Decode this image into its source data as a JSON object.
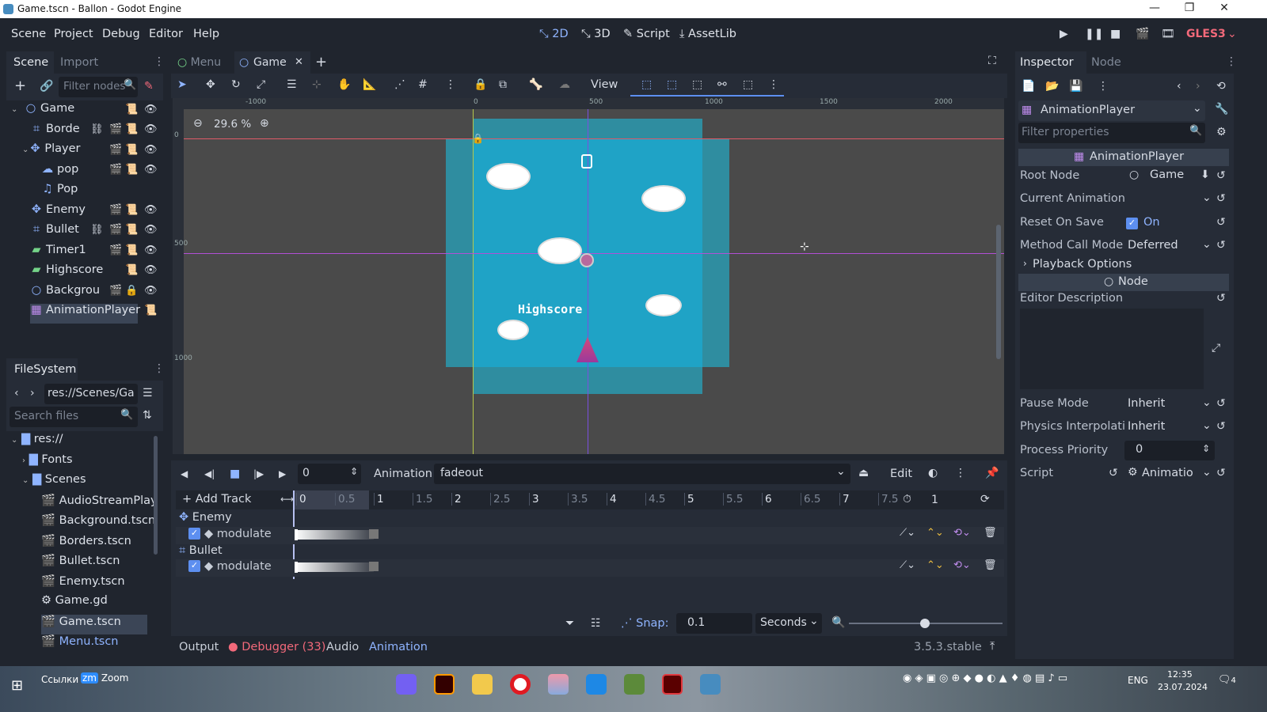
{
  "window": {
    "title": "Game.tscn - Ballon - Godot Engine"
  },
  "menubar": {
    "items": [
      "Scene",
      "Project",
      "Debug",
      "Editor",
      "Help"
    ],
    "workspaces": [
      "2D",
      "3D",
      "Script",
      "AssetLib"
    ],
    "renderer": "GLES3"
  },
  "scene_dock": {
    "tabs": [
      "Scene",
      "Import"
    ],
    "filter_placeholder": "Filter nodes",
    "nodes": [
      {
        "name": "Game",
        "depth": 0,
        "icon": "circle"
      },
      {
        "name": "Borde",
        "depth": 1,
        "icon": "static"
      },
      {
        "name": "Player",
        "depth": 1,
        "icon": "kinematic"
      },
      {
        "name": "pop",
        "depth": 2,
        "icon": "particles"
      },
      {
        "name": "Pop",
        "depth": 2,
        "icon": "audio"
      },
      {
        "name": "Enemy",
        "depth": 1,
        "icon": "kinematic"
      },
      {
        "name": "Bullet",
        "depth": 1,
        "icon": "static"
      },
      {
        "name": "Timer1",
        "depth": 1,
        "icon": "label"
      },
      {
        "name": "Highscore",
        "depth": 1,
        "icon": "label"
      },
      {
        "name": "Backgrou",
        "depth": 1,
        "icon": "circle"
      },
      {
        "name": "AnimationPlayer",
        "depth": 1,
        "icon": "anim"
      }
    ]
  },
  "filesystem": {
    "title": "FileSystem",
    "path": "res://Scenes/Ga",
    "search_placeholder": "Search files",
    "items": [
      {
        "name": "res://",
        "depth": 0,
        "type": "folder"
      },
      {
        "name": "Fonts",
        "depth": 1,
        "type": "folder"
      },
      {
        "name": "Scenes",
        "depth": 1,
        "type": "folder"
      },
      {
        "name": "AudioStreamPlay",
        "depth": 2,
        "type": "scene"
      },
      {
        "name": "Background.tscn",
        "depth": 2,
        "type": "scene"
      },
      {
        "name": "Borders.tscn",
        "depth": 2,
        "type": "scene"
      },
      {
        "name": "Bullet.tscn",
        "depth": 2,
        "type": "scene"
      },
      {
        "name": "Enemy.tscn",
        "depth": 2,
        "type": "scene"
      },
      {
        "name": "Game.gd",
        "depth": 2,
        "type": "script"
      },
      {
        "name": "Game.tscn",
        "depth": 2,
        "type": "scene"
      },
      {
        "name": "Menu.tscn",
        "depth": 2,
        "type": "scene"
      }
    ]
  },
  "editor_tabs": [
    "Menu",
    "Game"
  ],
  "toolbar": {
    "view_label": "View"
  },
  "viewport": {
    "zoom": "29.6 %",
    "ruler": [
      "-1000",
      "0",
      "500",
      "1000",
      "1500",
      "2000"
    ],
    "vruler": [
      "0",
      "500",
      "1000"
    ],
    "highscore_text": "Highscore"
  },
  "animation": {
    "time": "0",
    "label": "Animation",
    "current": "fadeout",
    "edit": "Edit",
    "add_track": "Add Track",
    "length": "1",
    "timeline": [
      "0",
      "0.5",
      "1",
      "1.5",
      "2",
      "2.5",
      "3",
      "3.5",
      "4",
      "4.5",
      "5",
      "5.5",
      "6",
      "6.5",
      "7",
      "7.5"
    ],
    "tracks": [
      {
        "node": "Enemy",
        "property": "modulate"
      },
      {
        "node": "Bullet",
        "property": "modulate"
      }
    ],
    "snap_label": "Snap:",
    "snap": "0.1",
    "unit": "Seconds"
  },
  "bottom_tabs": {
    "output": "Output",
    "debugger": "Debugger (33)",
    "audio": "Audio",
    "animation": "Animation",
    "version": "3.5.3.stable"
  },
  "inspector": {
    "tabs": [
      "Inspector",
      "Node"
    ],
    "object": "AnimationPlayer",
    "filter_placeholder": "Filter properties",
    "section": "AnimationPlayer",
    "root_node_label": "Root Node",
    "root_node": "Game",
    "current_animation_label": "Current Animation",
    "reset_label": "Reset On Save",
    "reset": "On",
    "method_label": "Method Call Mode",
    "method": "Deferred",
    "playback": "Playback Options",
    "node_section": "Node",
    "desc_label": "Editor Description",
    "pause_label": "Pause Mode",
    "pause": "Inherit",
    "physics_label": "Physics Interpolati",
    "physics": "Inherit",
    "priority_label": "Process Priority",
    "priority": "0",
    "script_label": "Script",
    "script": "Animatio"
  },
  "taskbar": {
    "links": "Ссылки",
    "zoom": "Zoom",
    "lang": "ENG",
    "time": "12:35",
    "date": "23.07.2024",
    "notif": "4"
  }
}
